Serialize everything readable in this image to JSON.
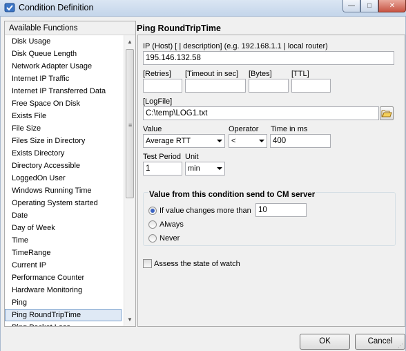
{
  "window": {
    "title": "Condition Definition",
    "min_glyph": "—",
    "max_glyph": "□",
    "close_glyph": "✕"
  },
  "functions": {
    "header": "Available Functions",
    "items": [
      {
        "label": "Disk Usage"
      },
      {
        "label": "Disk Queue Length"
      },
      {
        "label": "Network Adapter Usage"
      },
      {
        "label": "Internet IP Traffic"
      },
      {
        "label": "Internet IP Transferred Data"
      },
      {
        "label": "Free Space On Disk"
      },
      {
        "label": "Exists File"
      },
      {
        "label": "File Size"
      },
      {
        "label": "Files Size in Directory"
      },
      {
        "label": "Exists Directory"
      },
      {
        "label": "Directory Accessible"
      },
      {
        "label": "LoggedOn User"
      },
      {
        "label": "Windows Running Time"
      },
      {
        "label": "Operating System started"
      },
      {
        "label": "Date"
      },
      {
        "label": "Day of Week"
      },
      {
        "label": "Time"
      },
      {
        "label": "TimeRange"
      },
      {
        "label": "Current IP"
      },
      {
        "label": "Performance Counter"
      },
      {
        "label": "Hardware Monitoring"
      },
      {
        "label": "Ping"
      },
      {
        "label": "Ping RoundTripTime",
        "selected": true
      },
      {
        "label": "Ping Packet Loss"
      }
    ],
    "scroll_up": "▲",
    "scroll_down": "▼",
    "scroll_grip": "≡"
  },
  "detail": {
    "title": "Ping RoundTripTime",
    "host_label": "IP (Host) [ | description]  (e.g. 192.168.1.1 | local router)",
    "host_value": "195.146.132.58",
    "retries_label": "[Retries]",
    "retries_value": "",
    "timeout_label": "[Timeout in sec]",
    "timeout_value": "",
    "bytes_label": "[Bytes]",
    "bytes_value": "",
    "ttl_label": "[TTL]",
    "ttl_value": "",
    "logfile_label": "[LogFile]",
    "logfile_value": "C:\\temp\\LOG1.txt",
    "value_label": "Value",
    "value_selected": "Average RTT",
    "operator_label": "Operator",
    "operator_selected": "<",
    "time_label": "Time in ms",
    "time_value": "400",
    "test_period_label": "Test Period",
    "test_period_value": "1",
    "unit_label": "Unit",
    "unit_selected": "min"
  },
  "send_group": {
    "title": "Value from this condition send to CM server",
    "options": [
      {
        "label": "If value changes more than",
        "checked": true
      },
      {
        "label": "Always",
        "checked": false
      },
      {
        "label": "Never",
        "checked": false
      }
    ],
    "threshold_value": "10"
  },
  "assess": {
    "label": "Assess the state of watch",
    "checked": false
  },
  "buttons": {
    "ok": "OK",
    "cancel": "Cancel"
  },
  "colors": {
    "selection_fill": "#dfe9f5",
    "selection_border": "#7da2ce",
    "radio_dot": "#3a63c2",
    "folder_icon": "#e8b640"
  }
}
